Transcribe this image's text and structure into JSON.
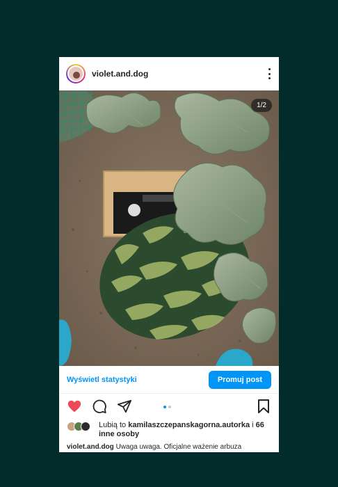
{
  "post": {
    "username": "violet.and.dog",
    "counter": "1/2",
    "stats_link": "Wyświetl statystyki",
    "promote_button": "Promuj post",
    "likes": {
      "prefix": "Lubią to",
      "liked_by": "kamilaszczepanskagorna.autorka",
      "middle": "i",
      "others": "66 inne osoby"
    },
    "caption": {
      "username": "violet.and.dog",
      "text": "Uwaga uwaga. Oficjalne ważenie arbuza"
    },
    "icons": [
      "more-options-icon",
      "heart-icon",
      "comment-icon",
      "share-icon",
      "bookmark-icon"
    ],
    "carousel": {
      "count": 2,
      "active": 1
    }
  },
  "colors": {
    "background": "#022c2b",
    "accent": "#0095f6",
    "heart": "#ed4956"
  }
}
